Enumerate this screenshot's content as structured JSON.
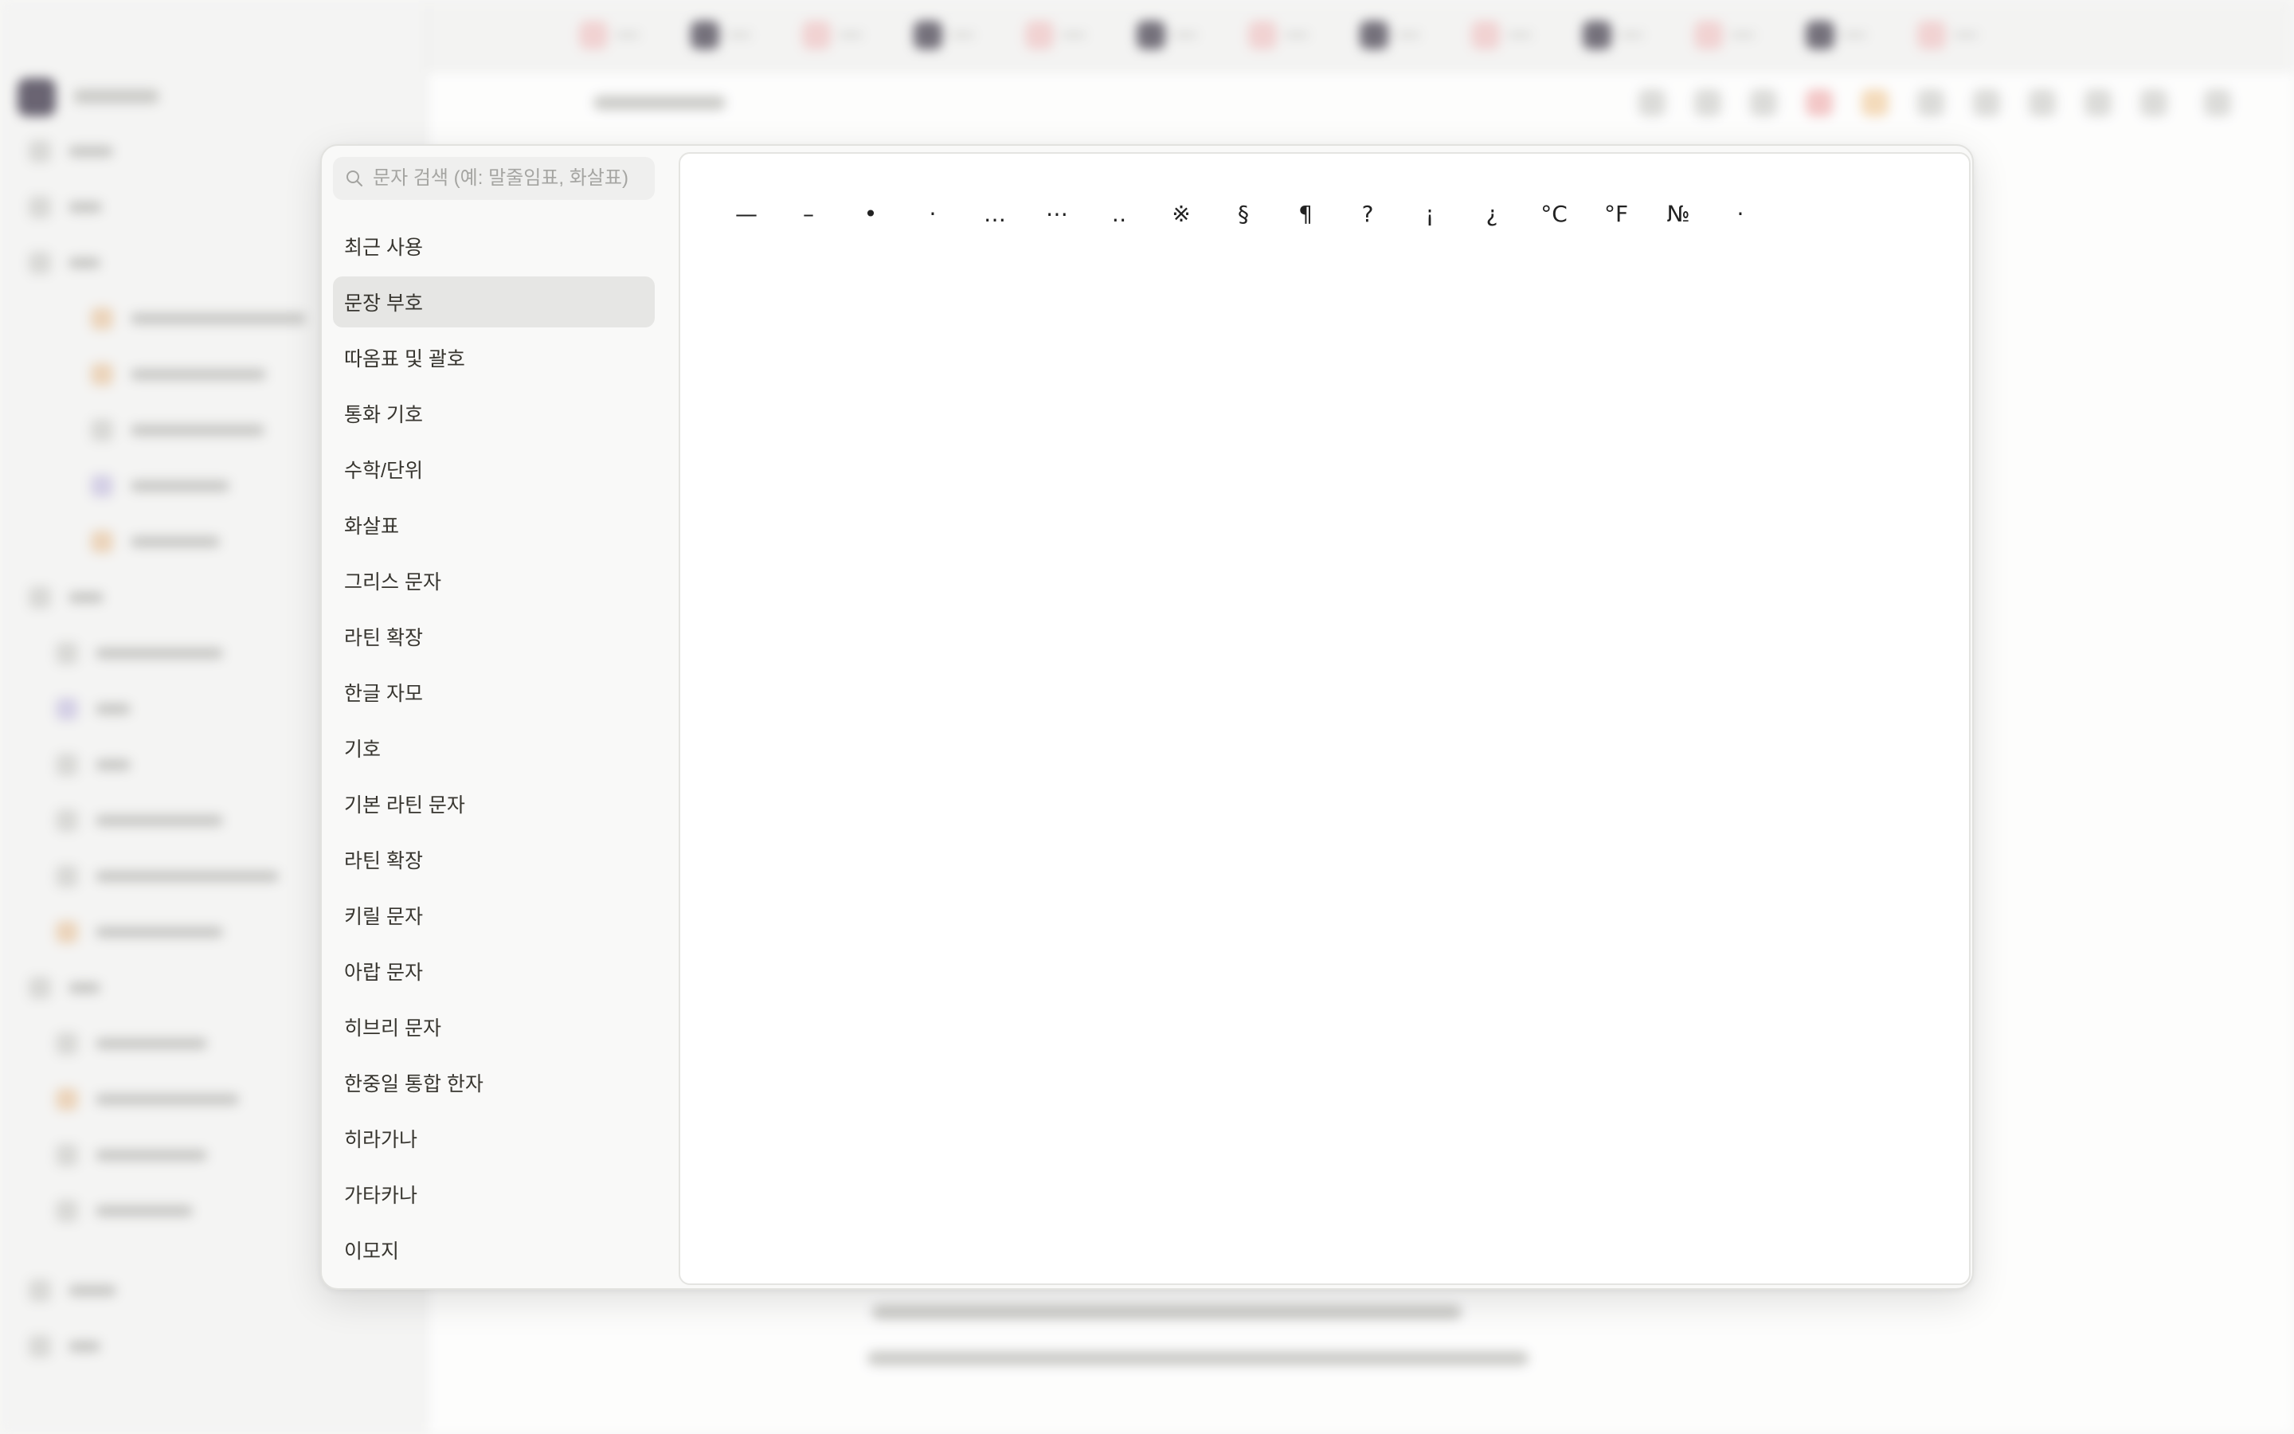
{
  "search": {
    "placeholder": "문자 검색 (예: 말줄임표, 화살표)"
  },
  "categories": [
    {
      "label": "최근 사용",
      "active": false
    },
    {
      "label": "문장 부호",
      "active": true
    },
    {
      "label": "따옴표 및 괄호",
      "active": false
    },
    {
      "label": "통화 기호",
      "active": false
    },
    {
      "label": "수학/단위",
      "active": false
    },
    {
      "label": "화살표",
      "active": false
    },
    {
      "label": "그리스 문자",
      "active": false
    },
    {
      "label": "라틴 확장",
      "active": false
    },
    {
      "label": "한글 자모",
      "active": false
    },
    {
      "label": "기호",
      "active": false
    },
    {
      "label": "기본 라틴 문자",
      "active": false
    },
    {
      "label": "라틴 확장",
      "active": false
    },
    {
      "label": "키릴 문자",
      "active": false
    },
    {
      "label": "아랍 문자",
      "active": false
    },
    {
      "label": "히브리 문자",
      "active": false
    },
    {
      "label": "한중일 통합 한자",
      "active": false
    },
    {
      "label": "히라가나",
      "active": false
    },
    {
      "label": "가타카나",
      "active": false
    },
    {
      "label": "이모지",
      "active": false
    }
  ],
  "characters": [
    "—",
    "–",
    "•",
    "·",
    "…",
    "⋯",
    "‥",
    "※",
    "§",
    "¶",
    "?",
    "¡",
    "¿",
    "°C",
    "°F",
    "№",
    "·"
  ],
  "colors": {
    "dialog_bg": "#f9f9f8",
    "active_category_bg": "#e6e6e4",
    "text": "#37352f",
    "placeholder": "#a5a5a2"
  },
  "icons": {
    "search": "search-icon"
  }
}
